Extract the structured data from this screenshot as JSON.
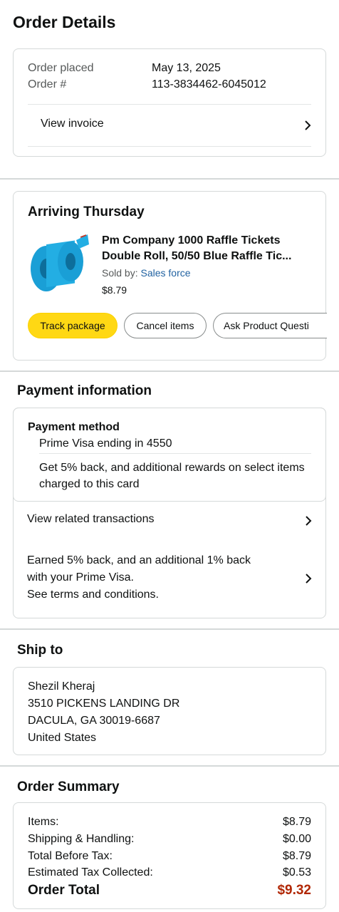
{
  "page": {
    "title": "Order Details"
  },
  "order_info": {
    "placed_label": "Order placed",
    "placed_value": "May 13, 2025",
    "number_label": "Order #",
    "number_value": "113-3834462-6045012",
    "view_invoice": "View invoice"
  },
  "shipment": {
    "status": "Arriving Thursday",
    "product_name": "Pm Company 1000 Raffle Tickets Double Roll, 50/50 Blue Raffle Tic...",
    "sold_by_label": "Sold by:",
    "seller": "Sales force",
    "price": "$8.79",
    "buttons": {
      "track": "Track package",
      "cancel": "Cancel items",
      "ask": "Ask Product Questi"
    }
  },
  "payment": {
    "title": "Payment information",
    "method_label": "Payment method",
    "card": "Prime Visa  ending in 4550",
    "promo": "Get 5% back, and additional rewards on select items charged to this card",
    "view_transactions": "View related transactions",
    "earned_line1": "Earned 5% back, and an additional 1% back",
    "earned_line2": "with your Prime Visa.",
    "earned_line3": "See terms and conditions."
  },
  "ship_to": {
    "title": "Ship to",
    "name": "Shezil Kheraj",
    "street": "3510 PICKENS LANDING DR",
    "city": "DACULA, GA 30019-6687",
    "country": "United States"
  },
  "summary": {
    "title": "Order Summary",
    "rows": [
      {
        "label": "Items:",
        "value": "$8.79"
      },
      {
        "label": "Shipping & Handling:",
        "value": "$0.00"
      },
      {
        "label": "Total Before Tax:",
        "value": "$8.79"
      },
      {
        "label": "Estimated Tax Collected:",
        "value": "$0.53"
      }
    ],
    "total_label": "Order Total",
    "total_value": "$9.32"
  },
  "colors": {
    "accent_button": "#ffd814",
    "seller_link": "#2162a1",
    "total_price": "#b12704",
    "border": "#d5d9d9"
  },
  "icons": [
    "chevron-right-icon",
    "raffle-ticket-roll-image"
  ]
}
